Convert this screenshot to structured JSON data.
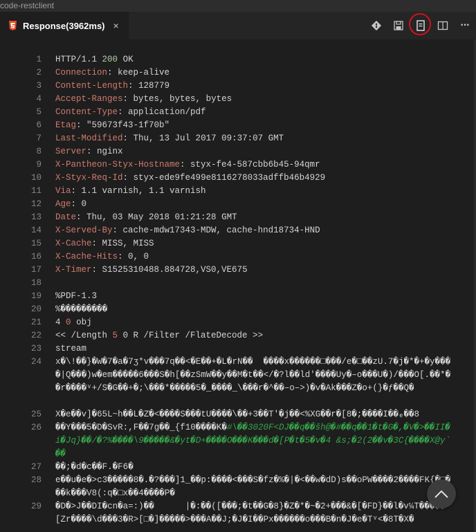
{
  "window": {
    "title": "code-restclient"
  },
  "tab": {
    "label": "Response(3962ms)",
    "close_glyph": "×",
    "icon": "html5-icon"
  },
  "toolbar": {
    "icons": [
      "git-icon",
      "save-icon",
      "preview-document-icon",
      "split-editor-icon",
      "more-icon"
    ],
    "more_glyph": "···"
  },
  "colors": {
    "header_name": "#ce7b6e",
    "number": "#b5cea8",
    "highlight_ring": "#d0121a"
  },
  "response": {
    "status": {
      "protocol": "HTTP/1.1",
      "code": "200",
      "reason": "OK"
    },
    "headers": [
      {
        "name": "Connection",
        "value": "keep-alive"
      },
      {
        "name": "Content-Length",
        "value": "128779"
      },
      {
        "name": "Accept-Ranges",
        "value": "bytes, bytes, bytes"
      },
      {
        "name": "Content-Type",
        "value": "application/pdf"
      },
      {
        "name": "Etag",
        "value": "\"59673f43-1f70b\""
      },
      {
        "name": "Last-Modified",
        "value": "Thu, 13 Jul 2017 09:37:07 GMT"
      },
      {
        "name": "Server",
        "value": "nginx"
      },
      {
        "name": "X-Pantheon-Styx-Hostname",
        "value": "styx-fe4-587cbb6b45-94qmr"
      },
      {
        "name": "X-Styx-Req-Id",
        "value": "styx-ede9fe499e8116278033adffb46b4929"
      },
      {
        "name": "Via",
        "value": "1.1 varnish, 1.1 varnish"
      },
      {
        "name": "Age",
        "value": "0"
      },
      {
        "name": "Date",
        "value": "Thu, 03 May 2018 01:21:28 GMT"
      },
      {
        "name": "X-Served-By",
        "value": "cache-mdw17343-MDW, cache-hnd18734-HND"
      },
      {
        "name": "X-Cache",
        "value": "MISS, MISS"
      },
      {
        "name": "X-Cache-Hits",
        "value": "0, 0"
      },
      {
        "name": "X-Timer",
        "value": "S1525310488.884728,VS0,VE675"
      }
    ],
    "body": {
      "pdf_version": "%PDF-1.3",
      "binary_marker": "%���������",
      "obj_num": "4",
      "obj_gen": "0",
      "obj_kw": "obj",
      "dict_open": "<< /Length ",
      "length_ref_num": "5",
      "dict_rest": " 0 R /Filter /FlateDecode >>",
      "stream_kw": "stream",
      "line24": "x�\\!��}�W�7�a�7ʒ*v���7q��<�E��+�L�rN��  ����x������□���/e�□��zU.7�j�*�+�y����|Q���)w�em�����6���S�h[��zSmW��y��M�t��</�?l��ld'����Uy�–o���U�)/���O[.��*��r����ᵛ+/S�G��+�;\\���*�����5�_����_\\���r�^��–o–>)�v�Ak���Z�o+(}�ƒ��Q�",
      "line25": "X�e��v]�65L~h��L�Z�<����S���tU����\\��+3��T'�j��<%XG��r�[8�;����I��ₑ��8",
      "line26_plain": "��Y���5�D�SvR:,F��7g��_{f10����K�",
      "line26_green": "#\\��3020F<DJ��q��šh@�#��q��1�t�G�,�V�>��II�i�Jq}��/�?%����\\9�����&�yt�D+����O���K���d�[P�t�5�v�4 &s;�2(2��v�3C{����X@y`��",
      "line27": "��;�d�c��F.�F6�",
      "line28": "e��u�e�>c3�����8�.�?���]1_��p:����<���S�fz�%�|�<��w�dD)s��oPW����2����FK{�□���k���V8(:q�□x��4����P�",
      "line29": "�D�>J��DI�cn�a=:)��      |�:��([���;�t��G�8}�Z�*�~�2+���&�[�FD}��l�v¼T�����[Zr����\\d���3�R>[□�]�����>���A��J;�J�I��Px������o���B�n�J�e�Tᵛ<�8T�X�"
    }
  }
}
